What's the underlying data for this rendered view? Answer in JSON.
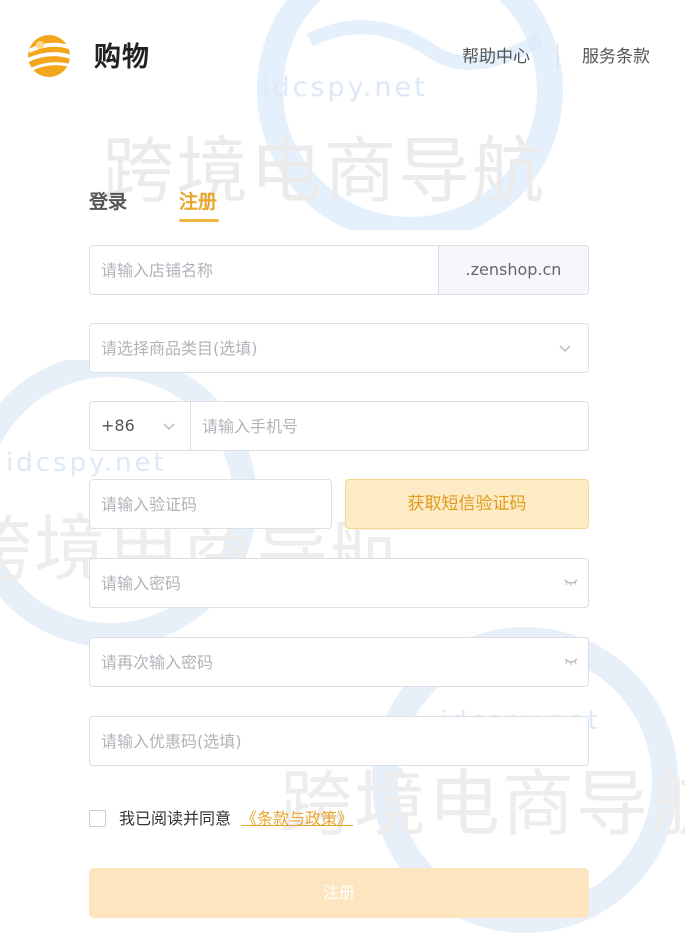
{
  "header": {
    "brand": "购物",
    "help_link": "帮助中心",
    "terms_link": "服务条款"
  },
  "watermark": {
    "domain": "idcspy.net",
    "text": "跨境电商导航"
  },
  "tabs": [
    {
      "label": "登录",
      "active": false
    },
    {
      "label": "注册",
      "active": true
    }
  ],
  "form": {
    "store_name": {
      "placeholder": "请输入店铺名称",
      "suffix": ".zenshop.cn"
    },
    "category": {
      "placeholder": "请选择商品类目(选填)"
    },
    "phone": {
      "country_code": "+86",
      "placeholder": "请输入手机号"
    },
    "sms_code": {
      "placeholder": "请输入验证码",
      "button": "获取短信验证码"
    },
    "password": {
      "placeholder": "请输入密码"
    },
    "password_confirm": {
      "placeholder": "请再次输入密码"
    },
    "coupon": {
      "placeholder": "请输入优惠码(选填)"
    },
    "agreement": {
      "text": "我已阅读并同意",
      "link": "《条款与政策》",
      "checked": false
    },
    "submit": "注册"
  },
  "colors": {
    "accent": "#e9a52e",
    "button_bg": "#fdebc5",
    "submit_bg": "#fce5bf",
    "border": "#dcdfe6"
  }
}
